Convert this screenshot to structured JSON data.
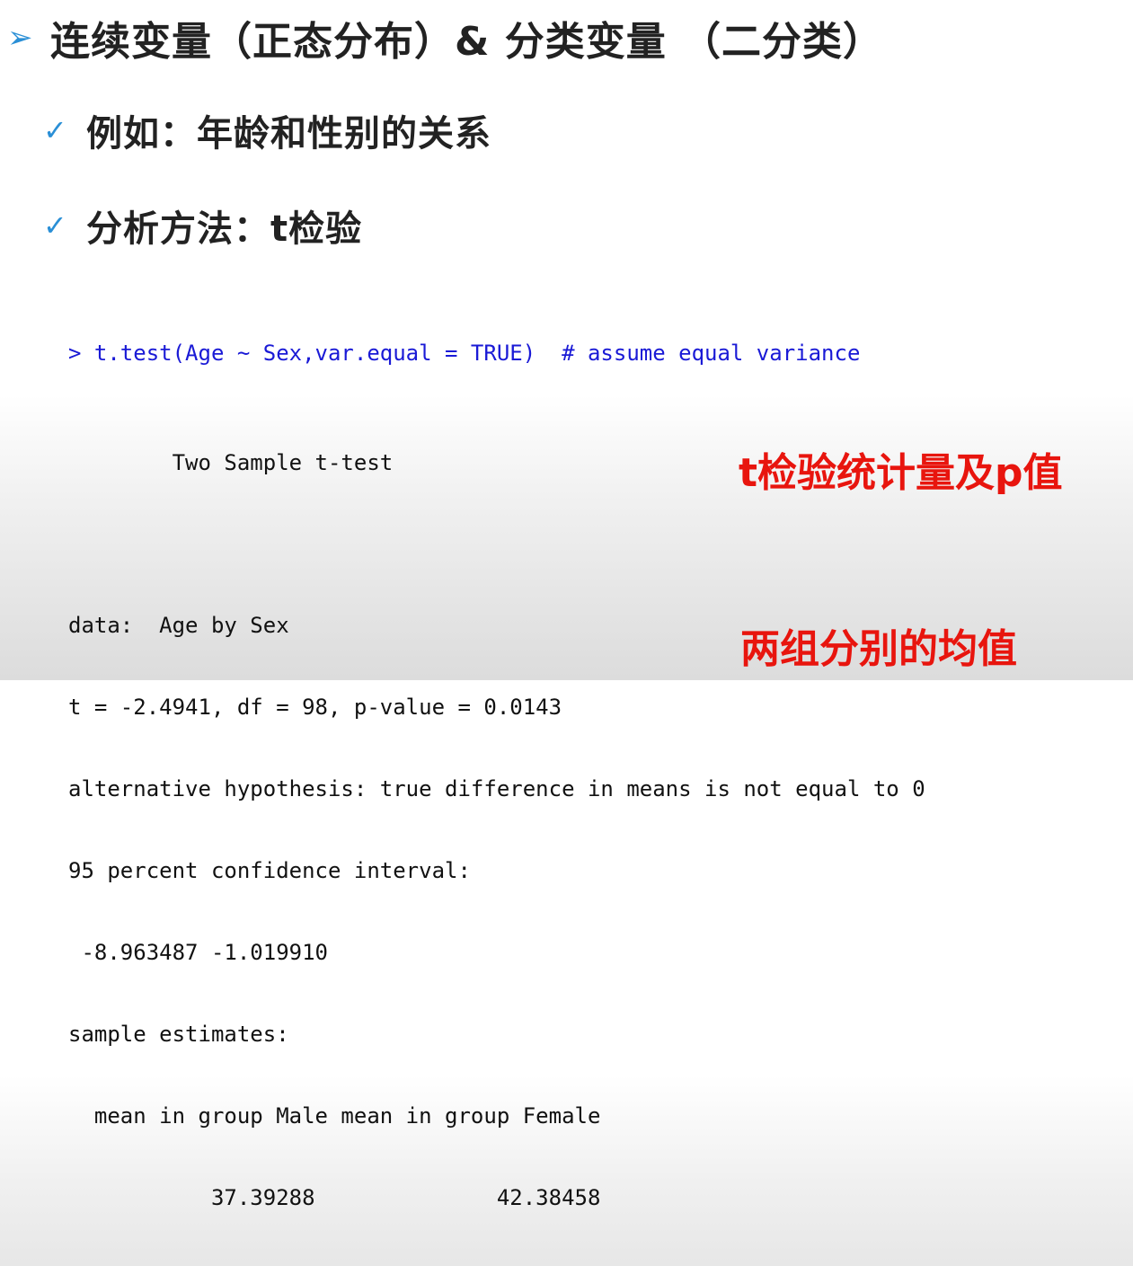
{
  "heading": {
    "bullet_glyph": "➢",
    "text": "连续变量（正态分布）& 分类变量 （二分类）"
  },
  "bullets": [
    {
      "glyph": "✓",
      "text": "例如：年龄和性别的关系"
    },
    {
      "glyph": "✓",
      "text": "分析方法：t检验"
    }
  ],
  "code": {
    "command": "> t.test(Age ~ Sex,var.equal = TRUE)  # assume equal variance",
    "output": [
      "        Two Sample t-test",
      "",
      "data:  Age by Sex",
      "t = -2.4941, df = 98, p-value = 0.0143",
      "alternative hypothesis: true difference in means is not equal to 0",
      "95 percent confidence interval:",
      " -8.963487 -1.019910",
      "sample estimates:",
      "  mean in group Male mean in group Female",
      "           37.39288              42.38458"
    ]
  },
  "annotations": {
    "stat_label": "t检验统计量及p值",
    "means_label": "两组分别的均值"
  },
  "colors": {
    "accent": "#2a8fd6",
    "command_text": "#1a1ad6",
    "annotation": "#e8150e"
  }
}
